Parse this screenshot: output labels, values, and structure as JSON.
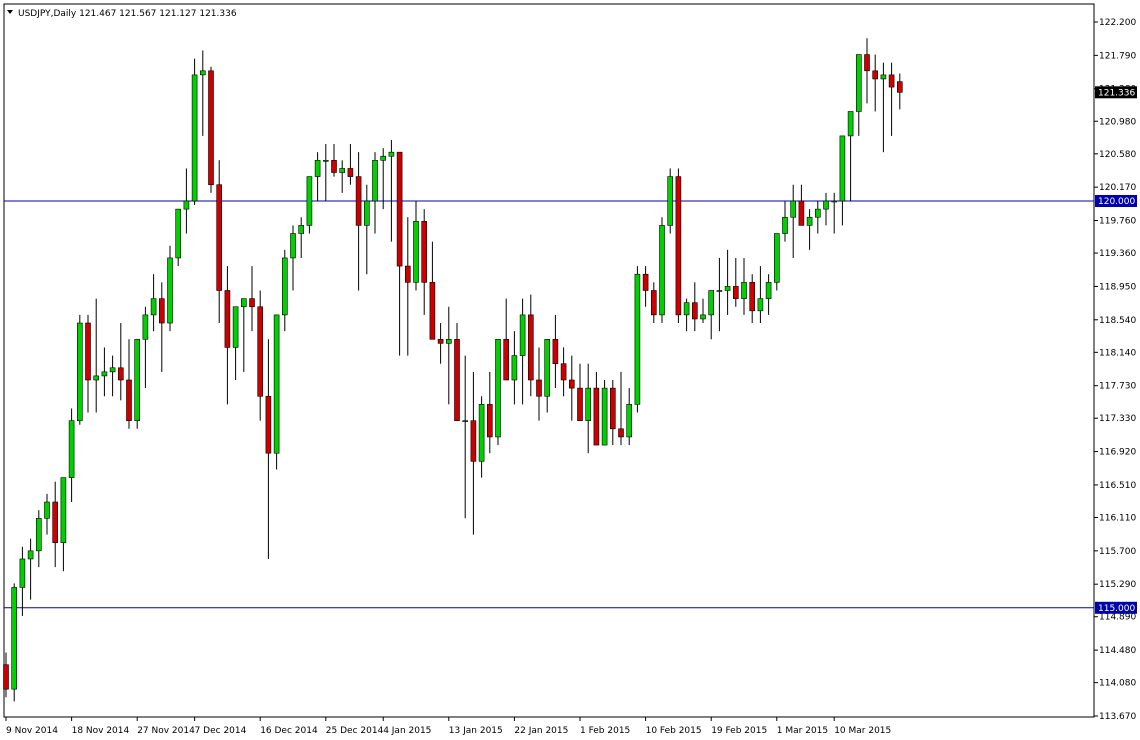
{
  "header": {
    "symbol": "USDJPY",
    "timeframe": "Daily",
    "open": "121.467",
    "high": "121.567",
    "low": "121.127",
    "close": "121.336",
    "dropdown_icon": "triangle-down-icon"
  },
  "colors": {
    "background": "#ffffff",
    "axis": "#000000",
    "bull_body": "#00d000",
    "bear_body": "#cc0000",
    "wick": "#000000",
    "hline": "#0000aa",
    "price_tag_bg": "#000000",
    "price_tag_text": "#ffffff",
    "level_tag_bg": "#0000aa"
  },
  "chart_data": {
    "type": "candlestick",
    "title": "USDJPY,Daily",
    "y_ticks": [
      "122.200",
      "121.790",
      "121.380",
      "120.980",
      "120.580",
      "120.170",
      "119.760",
      "119.360",
      "118.950",
      "118.540",
      "118.140",
      "117.730",
      "117.330",
      "116.920",
      "116.510",
      "116.110",
      "115.700",
      "115.290",
      "114.890",
      "114.480",
      "114.080",
      "113.670"
    ],
    "y_range": [
      113.67,
      122.2
    ],
    "x_ticks": [
      {
        "label": "9 Nov 2014",
        "index": 0
      },
      {
        "label": "18 Nov 2014",
        "index": 8
      },
      {
        "label": "27 Nov 2014",
        "index": 16
      },
      {
        "label": "7 Dec 2014",
        "index": 23
      },
      {
        "label": "16 Dec 2014",
        "index": 31
      },
      {
        "label": "25 Dec 2014",
        "index": 39
      },
      {
        "label": "4 Jan 2015",
        "index": 46
      },
      {
        "label": "13 Jan 2015",
        "index": 54
      },
      {
        "label": "22 Jan 2015",
        "index": 62
      },
      {
        "label": "1 Feb 2015",
        "index": 70
      },
      {
        "label": "10 Feb 2015",
        "index": 78
      },
      {
        "label": "19 Feb 2015",
        "index": 86
      },
      {
        "label": "1 Mar 2015",
        "index": 94
      },
      {
        "label": "10 Mar 2015",
        "index": 101
      }
    ],
    "horizontal_lines": [
      {
        "value": 120.0,
        "label": "120.000"
      },
      {
        "value": 115.0,
        "label": "115.000"
      }
    ],
    "current_price": {
      "value": 121.336,
      "label": "121.336"
    },
    "ohlc": [
      [
        114.3,
        114.45,
        113.9,
        114.0
      ],
      [
        114.0,
        115.3,
        113.85,
        115.25
      ],
      [
        115.25,
        115.75,
        114.9,
        115.6
      ],
      [
        115.6,
        115.85,
        115.1,
        115.7
      ],
      [
        115.7,
        116.2,
        115.5,
        116.1
      ],
      [
        116.1,
        116.4,
        115.9,
        116.3
      ],
      [
        116.3,
        116.55,
        115.5,
        115.8
      ],
      [
        115.8,
        116.6,
        115.45,
        116.6
      ],
      [
        116.6,
        117.45,
        116.3,
        117.3
      ],
      [
        117.3,
        118.6,
        117.25,
        118.5
      ],
      [
        118.5,
        118.6,
        117.4,
        117.8
      ],
      [
        117.8,
        118.8,
        117.4,
        117.85
      ],
      [
        117.85,
        118.2,
        117.6,
        117.9
      ],
      [
        117.9,
        118.1,
        117.6,
        117.95
      ],
      [
        117.95,
        118.5,
        117.55,
        117.8
      ],
      [
        117.8,
        118.3,
        117.2,
        117.3
      ],
      [
        117.3,
        118.3,
        117.2,
        118.3
      ],
      [
        118.3,
        118.7,
        117.7,
        118.6
      ],
      [
        118.6,
        119.1,
        118.4,
        118.8
      ],
      [
        118.8,
        119.0,
        117.9,
        118.5
      ],
      [
        118.5,
        119.45,
        118.4,
        119.3
      ],
      [
        119.3,
        119.9,
        119.2,
        119.9
      ],
      [
        119.9,
        120.4,
        119.6,
        120.0
      ],
      [
        120.0,
        121.75,
        119.95,
        121.55
      ],
      [
        121.55,
        121.85,
        120.8,
        121.6
      ],
      [
        121.6,
        121.65,
        120.1,
        120.2
      ],
      [
        120.2,
        120.5,
        118.5,
        118.9
      ],
      [
        118.9,
        119.2,
        117.5,
        118.2
      ],
      [
        118.2,
        118.7,
        117.8,
        118.7
      ],
      [
        118.7,
        118.8,
        117.9,
        118.8
      ],
      [
        118.8,
        119.2,
        118.4,
        118.7
      ],
      [
        118.7,
        118.9,
        117.3,
        117.6
      ],
      [
        117.6,
        118.3,
        115.6,
        116.9
      ],
      [
        116.9,
        118.6,
        116.7,
        118.6
      ],
      [
        118.6,
        119.4,
        118.4,
        119.3
      ],
      [
        119.3,
        119.7,
        118.9,
        119.6
      ],
      [
        119.6,
        119.8,
        119.3,
        119.7
      ],
      [
        119.7,
        120.2,
        119.6,
        120.3
      ],
      [
        120.3,
        120.6,
        120.0,
        120.5
      ],
      [
        120.5,
        120.7,
        120.0,
        120.5
      ],
      [
        120.5,
        120.7,
        120.3,
        120.35
      ],
      [
        120.35,
        120.5,
        120.1,
        120.4
      ],
      [
        120.4,
        120.7,
        120.2,
        120.3
      ],
      [
        120.3,
        120.6,
        118.9,
        119.7
      ],
      [
        119.7,
        120.2,
        119.1,
        120.0
      ],
      [
        120.0,
        120.6,
        119.6,
        120.5
      ],
      [
        120.5,
        120.65,
        119.9,
        120.55
      ],
      [
        120.55,
        120.75,
        119.5,
        120.6
      ],
      [
        120.6,
        120.6,
        118.1,
        119.2
      ],
      [
        119.2,
        119.8,
        118.1,
        119.0
      ],
      [
        119.0,
        120.0,
        118.9,
        119.75
      ],
      [
        119.75,
        119.9,
        118.6,
        119.0
      ],
      [
        119.0,
        119.5,
        118.6,
        118.3
      ],
      [
        118.3,
        118.5,
        118.0,
        118.25
      ],
      [
        118.25,
        118.7,
        117.5,
        118.3
      ],
      [
        118.3,
        118.5,
        117.3,
        117.3
      ],
      [
        117.3,
        118.1,
        116.1,
        117.3
      ],
      [
        117.3,
        117.9,
        115.9,
        116.8
      ],
      [
        116.8,
        117.6,
        116.6,
        117.5
      ],
      [
        117.5,
        117.9,
        116.9,
        117.1
      ],
      [
        117.1,
        118.2,
        117.0,
        118.3
      ],
      [
        118.3,
        118.8,
        117.8,
        117.8
      ],
      [
        117.8,
        118.4,
        117.5,
        118.1
      ],
      [
        118.1,
        118.8,
        117.5,
        118.6
      ],
      [
        118.6,
        118.85,
        117.6,
        117.8
      ],
      [
        117.8,
        118.2,
        117.3,
        117.6
      ],
      [
        117.6,
        118.2,
        117.4,
        118.3
      ],
      [
        118.3,
        118.6,
        117.7,
        118.0
      ],
      [
        118.0,
        118.2,
        117.6,
        117.8
      ],
      [
        117.8,
        118.1,
        117.3,
        117.7
      ],
      [
        117.7,
        118.0,
        117.3,
        117.3
      ],
      [
        117.3,
        118.0,
        116.9,
        117.7
      ],
      [
        117.7,
        117.9,
        117.0,
        117.0
      ],
      [
        117.0,
        117.8,
        117.0,
        117.7
      ],
      [
        117.7,
        117.8,
        117.0,
        117.2
      ],
      [
        117.2,
        117.9,
        117.0,
        117.1
      ],
      [
        117.1,
        117.7,
        117.0,
        117.5
      ],
      [
        117.5,
        119.2,
        117.4,
        119.1
      ],
      [
        119.1,
        119.2,
        118.7,
        118.9
      ],
      [
        118.9,
        119.0,
        118.5,
        118.6
      ],
      [
        118.6,
        119.8,
        118.5,
        119.7
      ],
      [
        119.7,
        120.4,
        119.6,
        120.3
      ],
      [
        120.3,
        120.4,
        118.5,
        118.6
      ],
      [
        118.6,
        118.8,
        118.4,
        118.75
      ],
      [
        118.75,
        119.0,
        118.4,
        118.55
      ],
      [
        118.55,
        118.8,
        118.5,
        118.6
      ],
      [
        118.6,
        118.9,
        118.3,
        118.9
      ],
      [
        118.9,
        119.3,
        118.4,
        118.9
      ],
      [
        118.9,
        119.4,
        118.6,
        118.95
      ],
      [
        118.95,
        119.3,
        118.7,
        118.8
      ],
      [
        118.8,
        119.3,
        118.6,
        119.0
      ],
      [
        119.0,
        119.1,
        118.5,
        118.65
      ],
      [
        118.65,
        119.2,
        118.5,
        118.8
      ],
      [
        118.8,
        119.1,
        118.6,
        119.0
      ],
      [
        119.0,
        119.6,
        118.9,
        119.6
      ],
      [
        119.6,
        120.0,
        119.5,
        119.8
      ],
      [
        119.8,
        120.2,
        119.3,
        120.0
      ],
      [
        120.0,
        120.2,
        119.7,
        119.7
      ],
      [
        119.7,
        119.9,
        119.4,
        119.8
      ],
      [
        119.8,
        120.0,
        119.6,
        119.9
      ],
      [
        119.9,
        120.1,
        119.7,
        120.0
      ],
      [
        120.0,
        120.1,
        119.6,
        120.0
      ],
      [
        120.0,
        120.2,
        119.7,
        120.8
      ],
      [
        120.8,
        121.0,
        120.0,
        121.1
      ],
      [
        121.1,
        121.6,
        120.8,
        121.8
      ],
      [
        121.8,
        122.0,
        121.2,
        121.6
      ],
      [
        121.6,
        121.8,
        121.1,
        121.5
      ],
      [
        121.5,
        121.7,
        120.6,
        121.55
      ],
      [
        121.55,
        121.7,
        120.8,
        121.4
      ],
      [
        121.467,
        121.567,
        121.127,
        121.336
      ]
    ]
  }
}
